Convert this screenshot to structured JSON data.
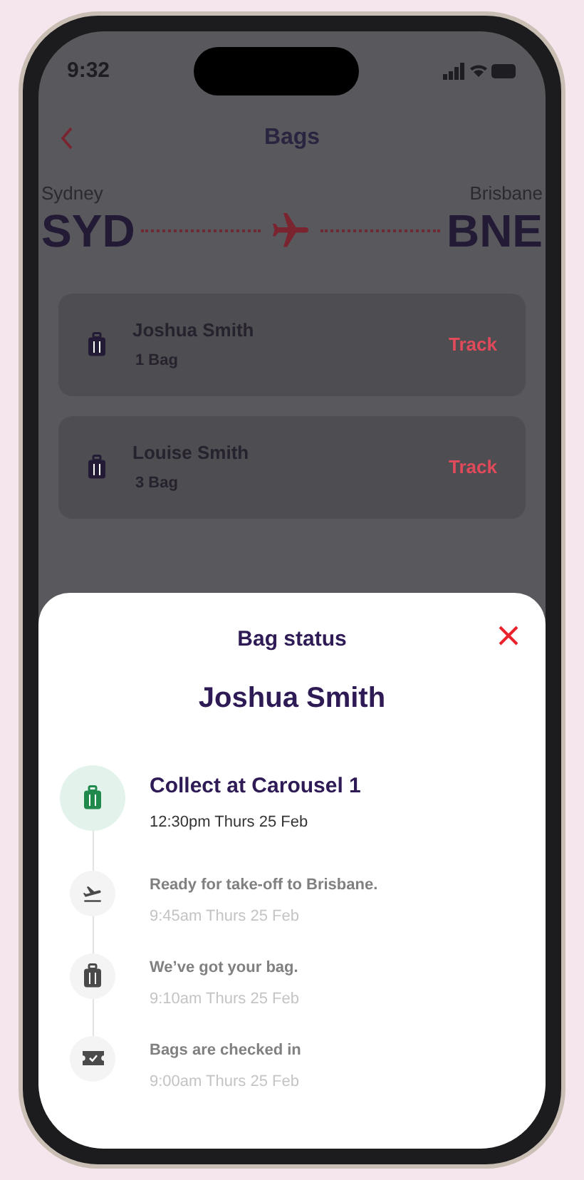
{
  "status_bar": {
    "time": "9:32"
  },
  "header": {
    "title": "Bags"
  },
  "route": {
    "from_city": "Sydney",
    "from_code": "SYD",
    "to_city": "Brisbane",
    "to_code": "BNE"
  },
  "passengers": [
    {
      "name": "Joshua Smith",
      "bags": "1 Bag",
      "action": "Track"
    },
    {
      "name": "Louise Smith",
      "bags": "3 Bag",
      "action": "Track"
    }
  ],
  "sheet": {
    "title": "Bag status",
    "passenger": "Joshua Smith",
    "steps": [
      {
        "title": "Collect at Carousel 1",
        "time": "12:30pm Thurs 25 Feb",
        "current": true
      },
      {
        "title": "Ready for take-off to Brisbane.",
        "time": "9:45am Thurs 25 Feb",
        "current": false
      },
      {
        "title": "We’ve got your bag.",
        "time": "9:10am Thurs 25 Feb",
        "current": false
      },
      {
        "title": "Bags are checked in",
        "time": "9:00am Thurs 25 Feb",
        "current": false
      }
    ]
  }
}
